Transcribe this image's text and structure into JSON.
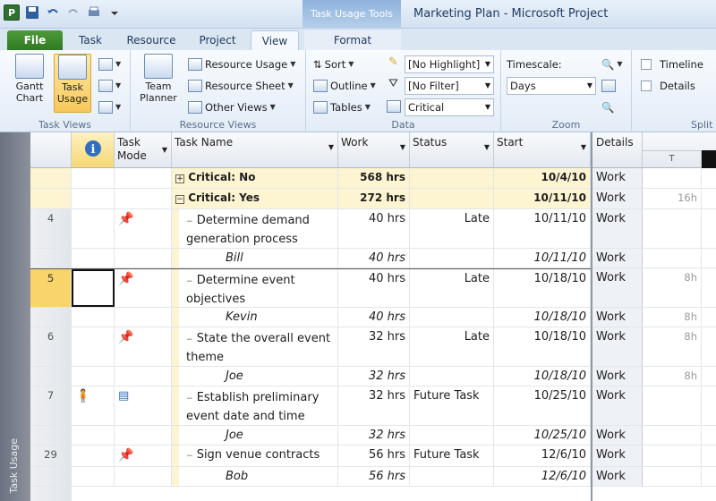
{
  "titlebar": {
    "app_icon": "P",
    "context_tab": "Task Usage Tools",
    "title": "Marketing Plan  -  Microsoft Project"
  },
  "tabs": [
    "File",
    "Task",
    "Resource",
    "Project",
    "View",
    "Format"
  ],
  "ribbon": {
    "task_views": {
      "label": "Task Views",
      "gantt": "Gantt Chart",
      "usage": "Task Usage"
    },
    "resource_views": {
      "label": "Resource Views",
      "team": "Team Planner",
      "usage": "Resource Usage",
      "sheet": "Resource Sheet",
      "other": "Other Views"
    },
    "data": {
      "label": "Data",
      "sort": "Sort",
      "outline": "Outline",
      "tables": "Tables",
      "highlight": "[No Highlight]",
      "filter": "[No Filter]",
      "group": "Critical"
    },
    "zoom": {
      "label": "Zoom",
      "timescale_label": "Timescale:",
      "timescale": "Days"
    },
    "split": {
      "label": "Split",
      "timeline": "Timeline",
      "details": "Details"
    }
  },
  "viewbar_label": "Task Usage",
  "columns": {
    "mode": "Task Mode",
    "name": "Task Name",
    "work": "Work",
    "status": "Status",
    "start": "Start",
    "details": "Details",
    "tp_day": "T"
  },
  "rows": [
    {
      "id": "",
      "name": "Critical: No",
      "work": "568 hrs",
      "status": "",
      "start": "10/4/10",
      "detail": "Work",
      "tp": ""
    },
    {
      "id": "",
      "name": "Critical: Yes",
      "work": "272 hrs",
      "status": "",
      "start": "10/11/10",
      "detail": "Work",
      "tp": "16h"
    },
    {
      "id": "4",
      "name": "Determine demand generation process",
      "work": "40 hrs",
      "status": "Late",
      "start": "10/11/10",
      "detail": "Work",
      "tp": ""
    },
    {
      "id": "",
      "name": "Bill",
      "work": "40 hrs",
      "status": "",
      "start": "10/11/10",
      "detail": "Work",
      "tp": ""
    },
    {
      "id": "5",
      "name": "Determine event objectives",
      "work": "40 hrs",
      "status": "Late",
      "start": "10/18/10",
      "detail": "Work",
      "tp": "8h"
    },
    {
      "id": "",
      "name": "Kevin",
      "work": "40 hrs",
      "status": "",
      "start": "10/18/10",
      "detail": "Work",
      "tp": "8h"
    },
    {
      "id": "6",
      "name": "State the overall event theme",
      "work": "32 hrs",
      "status": "Late",
      "start": "10/18/10",
      "detail": "Work",
      "tp": "8h"
    },
    {
      "id": "",
      "name": "Joe",
      "work": "32 hrs",
      "status": "",
      "start": "10/18/10",
      "detail": "Work",
      "tp": "8h"
    },
    {
      "id": "7",
      "name": "Establish preliminary event date and time",
      "work": "32 hrs",
      "status": "Future Task",
      "start": "10/25/10",
      "detail": "Work",
      "tp": ""
    },
    {
      "id": "",
      "name": "Joe",
      "work": "32 hrs",
      "status": "",
      "start": "10/25/10",
      "detail": "Work",
      "tp": ""
    },
    {
      "id": "29",
      "name": "Sign venue contracts",
      "work": "56 hrs",
      "status": "Future Task",
      "start": "12/6/10",
      "detail": "Work",
      "tp": ""
    },
    {
      "id": "",
      "name": "Bob",
      "work": "56 hrs",
      "status": "",
      "start": "12/6/10",
      "detail": "Work",
      "tp": ""
    }
  ]
}
